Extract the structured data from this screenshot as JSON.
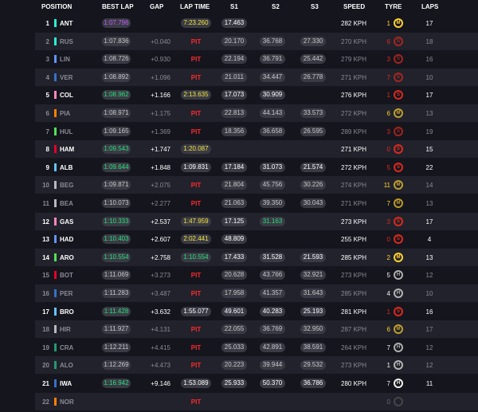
{
  "header": {
    "position": "POSITION",
    "best_lap": "BEST LAP",
    "gap": "GAP",
    "lap_time": "LAP TIME",
    "s1": "S1",
    "s2": "S2",
    "s3": "S3",
    "speed": "SPEED",
    "tyre": "TYRE",
    "laps": "LAPS"
  },
  "team_colors": {
    "mercedes": "#27f4d2",
    "red_bull": "#3671c6",
    "ferrari": "#e8002d",
    "mclaren": "#ff8000",
    "sauber": "#52e252",
    "williams": "#64c4ff",
    "alpine": "#ff87bc",
    "racing_bulls": "#6692ff",
    "aston_martin": "#229971",
    "haas": "#b6babd"
  },
  "tyre_colors": {
    "M": "#ffd12e",
    "S": "#da291c",
    "H": "#f0f0ec",
    "I": "#43b047",
    "W": "#0067ad"
  },
  "rows": [
    {
      "pos": "1",
      "code": "ANT",
      "team": "mercedes",
      "best": "1:07.796",
      "best_style": "purple",
      "gap": "",
      "lap_time": "7:23.260",
      "lap_style": "yellow",
      "pit": "",
      "s1": "17.463",
      "s2": "",
      "s3": "",
      "speed": "282 KPH",
      "tyre_laps": "1",
      "tyre": "M",
      "laps": "17",
      "grey": false
    },
    {
      "pos": "2",
      "code": "RUS",
      "team": "mercedes",
      "best": "1:07.836",
      "best_style": "fast",
      "gap": "+0.040",
      "lap_time": "",
      "pit": "PIT",
      "s1": "20.170",
      "s2": "36.768",
      "s3": "27.330",
      "speed": "270 KPH",
      "tyre_laps": "6",
      "tyre": "S",
      "laps": "18",
      "grey": true
    },
    {
      "pos": "3",
      "code": "LIN",
      "team": "racing_bulls",
      "best": "1:08.726",
      "best_style": "fast",
      "gap": "+0.930",
      "lap_time": "",
      "pit": "PIT",
      "s1": "22.194",
      "s2": "36.791",
      "s3": "25.442",
      "speed": "279 KPH",
      "tyre_laps": "3",
      "tyre": "S",
      "laps": "16",
      "grey": true
    },
    {
      "pos": "4",
      "code": "VER",
      "team": "red_bull",
      "best": "1:08.892",
      "best_style": "fast",
      "gap": "+1.096",
      "lap_time": "",
      "pit": "PIT",
      "s1": "21.011",
      "s2": "34.447",
      "s3": "26.778",
      "speed": "271 KPH",
      "tyre_laps": "7",
      "tyre": "S",
      "laps": "10",
      "grey": true
    },
    {
      "pos": "5",
      "code": "COL",
      "team": "alpine",
      "best": "1:08.962",
      "best_style": "fast",
      "gap": "+1.166",
      "lap_time": "2:13.635",
      "lap_style": "yellow",
      "pit": "",
      "s1": "17.073",
      "s2": "30.909",
      "s3": "",
      "speed": "276 KPH",
      "tyre_laps": "1",
      "tyre": "S",
      "laps": "17",
      "grey": false
    },
    {
      "pos": "6",
      "code": "PIA",
      "team": "mclaren",
      "best": "1:08.971",
      "best_style": "fast",
      "gap": "+1.175",
      "lap_time": "",
      "pit": "PIT",
      "s1": "22.813",
      "s2": "44.143",
      "s3": "33.573",
      "speed": "272 KPH",
      "tyre_laps": "6",
      "tyre": "M",
      "laps": "13",
      "grey": true
    },
    {
      "pos": "7",
      "code": "HUL",
      "team": "sauber",
      "best": "1:09.165",
      "best_style": "fast",
      "gap": "+1.369",
      "lap_time": "",
      "pit": "PIT",
      "s1": "18.356",
      "s2": "36.658",
      "s3": "26.595",
      "speed": "289 KPH",
      "tyre_laps": "3",
      "tyre": "S",
      "laps": "19",
      "grey": true
    },
    {
      "pos": "8",
      "code": "HAM",
      "team": "ferrari",
      "best": "1:09.543",
      "best_style": "fast",
      "gap": "+1.747",
      "lap_time": "1:20.087",
      "lap_style": "yellow",
      "pit": "",
      "s1": "",
      "s2": "",
      "s3": "",
      "speed": "271 KPH",
      "tyre_laps": "0",
      "tyre": "S",
      "laps": "15",
      "grey": false
    },
    {
      "pos": "9",
      "code": "ALB",
      "team": "williams",
      "best": "1:09.644",
      "best_style": "fast",
      "gap": "+1.848",
      "lap_time": "1:09.831",
      "lap_style": "plain",
      "pit": "",
      "s1": "17.184",
      "s2": "31.073",
      "s3": "21.574",
      "speed": "272 KPH",
      "tyre_laps": "5",
      "tyre": "S",
      "laps": "22",
      "grey": false
    },
    {
      "pos": "10",
      "code": "BEG",
      "team": "haas",
      "best": "1:09.871",
      "best_style": "fast",
      "gap": "+2.075",
      "lap_time": "",
      "pit": "PIT",
      "s1": "21.804",
      "s2": "45.756",
      "s3": "30.226",
      "speed": "274 KPH",
      "tyre_laps": "11",
      "tyre": "M",
      "laps": "14",
      "grey": true
    },
    {
      "pos": "11",
      "code": "BEA",
      "team": "haas",
      "best": "1:10.073",
      "best_style": "fast",
      "gap": "+2.277",
      "lap_time": "",
      "pit": "PIT",
      "s1": "21.063",
      "s2": "39.350",
      "s3": "30.043",
      "speed": "271 KPH",
      "tyre_laps": "7",
      "tyre": "M",
      "laps": "13",
      "grey": true
    },
    {
      "pos": "12",
      "code": "GAS",
      "team": "alpine",
      "best": "1:10.333",
      "best_style": "fast",
      "gap": "+2.537",
      "lap_time": "1:47.959",
      "lap_style": "yellow",
      "pit": "",
      "s1": "17.125",
      "s2": "31.163",
      "s2_style": "fast",
      "s3": "",
      "speed": "273 KPH",
      "tyre_laps": "3",
      "tyre": "S",
      "laps": "17",
      "grey": false
    },
    {
      "pos": "13",
      "code": "HAD",
      "team": "racing_bulls",
      "best": "1:10.403",
      "best_style": "fast",
      "gap": "+2.607",
      "lap_time": "2:02.441",
      "lap_style": "yellow",
      "pit": "",
      "s1": "48.809",
      "s2": "",
      "s3": "",
      "speed": "255 KPH",
      "tyre_laps": "0",
      "tyre": "S",
      "laps": "4",
      "grey": false
    },
    {
      "pos": "14",
      "code": "ARO",
      "team": "sauber",
      "best": "1:10.554",
      "best_style": "fast",
      "gap": "+2.758",
      "lap_time": "1:10.554",
      "lap_style": "fast",
      "pit": "",
      "s1": "17.433",
      "s2": "31.528",
      "s3": "21.593",
      "speed": "285 KPH",
      "tyre_laps": "2",
      "tyre": "M",
      "laps": "13",
      "grey": false
    },
    {
      "pos": "15",
      "code": "BOT",
      "team": "ferrari",
      "best": "1:11.069",
      "best_style": "fast",
      "gap": "+3.273",
      "lap_time": "",
      "pit": "PIT",
      "s1": "20.628",
      "s2": "43.766",
      "s3": "32.921",
      "speed": "273 KPH",
      "tyre_laps": "5",
      "tyre": "H",
      "laps": "12",
      "grey": true
    },
    {
      "pos": "16",
      "code": "PER",
      "team": "red_bull",
      "best": "1:11.283",
      "best_style": "fast",
      "gap": "+3.487",
      "lap_time": "",
      "pit": "PIT",
      "s1": "17.958",
      "s2": "41.357",
      "s3": "31.643",
      "speed": "285 KPH",
      "tyre_laps": "4",
      "tyre": "H",
      "laps": "10",
      "grey": true
    },
    {
      "pos": "17",
      "code": "BRO",
      "team": "williams",
      "best": "1:11.428",
      "best_style": "fast",
      "gap": "+3.632",
      "lap_time": "1:55.077",
      "lap_style": "plain",
      "pit": "",
      "s1": "49.601",
      "s2": "40.283",
      "s3": "25.193",
      "speed": "281 KPH",
      "tyre_laps": "1",
      "tyre": "S",
      "laps": "16",
      "grey": false
    },
    {
      "pos": "18",
      "code": "HIR",
      "team": "haas",
      "best": "1:11.927",
      "best_style": "fast",
      "gap": "+4.131",
      "lap_time": "",
      "pit": "PIT",
      "s1": "22.055",
      "s2": "36.769",
      "s3": "32.950",
      "speed": "287 KPH",
      "tyre_laps": "6",
      "tyre": "M",
      "laps": "17",
      "grey": true
    },
    {
      "pos": "19",
      "code": "CRA",
      "team": "aston_martin",
      "best": "1:12.211",
      "best_style": "fast",
      "gap": "+4.415",
      "lap_time": "",
      "pit": "PIT",
      "s1": "25.033",
      "s2": "42.891",
      "s3": "38.591",
      "speed": "264 KPH",
      "tyre_laps": "7",
      "tyre": "H",
      "laps": "12",
      "grey": true
    },
    {
      "pos": "20",
      "code": "ALO",
      "team": "aston_martin",
      "best": "1:12.269",
      "best_style": "fast",
      "gap": "+4.473",
      "lap_time": "",
      "pit": "PIT",
      "s1": "20.223",
      "s2": "39.944",
      "s3": "29.532",
      "speed": "273 KPH",
      "tyre_laps": "1",
      "tyre": "H",
      "laps": "12",
      "grey": true
    },
    {
      "pos": "21",
      "code": "IWA",
      "team": "red_bull",
      "best": "1:16.942",
      "best_style": "fast",
      "gap": "+9.146",
      "lap_time": "1:53.089",
      "lap_style": "plain",
      "pit": "",
      "s1": "25.933",
      "s2": "50.370",
      "s3": "36.786",
      "speed": "280 KPH",
      "tyre_laps": "7",
      "tyre": "H",
      "laps": "11",
      "grey": false
    },
    {
      "pos": "22",
      "code": "NOR",
      "team": "mclaren",
      "best": "",
      "best_style": "fast",
      "gap": "",
      "lap_time": "",
      "pit": "PIT",
      "s1": "",
      "s2": "",
      "s3": "",
      "speed": "",
      "tyre_laps": "0",
      "tyre": "",
      "laps": "",
      "grey": true
    }
  ]
}
